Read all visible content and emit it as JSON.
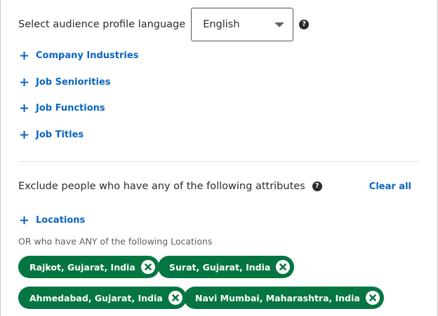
{
  "language": {
    "label": "Select audience profile language",
    "selected": "English",
    "help_icon": "question-circle-icon"
  },
  "include_attributes": [
    {
      "label": "Company Industries",
      "icon": "plus-icon"
    },
    {
      "label": "Job Seniorities",
      "icon": "plus-icon"
    },
    {
      "label": "Job Functions",
      "icon": "plus-icon"
    },
    {
      "label": "Job Titles",
      "icon": "plus-icon"
    }
  ],
  "exclude": {
    "label": "Exclude people who have any of the following attributes",
    "help_icon": "question-circle-icon",
    "clear_all": "Clear all",
    "locations_link": "Locations",
    "or_text": "OR who have ANY of the following Locations",
    "locations": [
      {
        "label": "Rajkot, Gujarat, India"
      },
      {
        "label": "Surat, Gujarat, India"
      },
      {
        "label": "Ahmedabad, Gujarat, India"
      },
      {
        "label": "Navi Mumbai, Maharashtra, India"
      }
    ]
  },
  "colors": {
    "link": "#0a66c2",
    "chip": "#057642",
    "divider": "#e4e4e4"
  }
}
